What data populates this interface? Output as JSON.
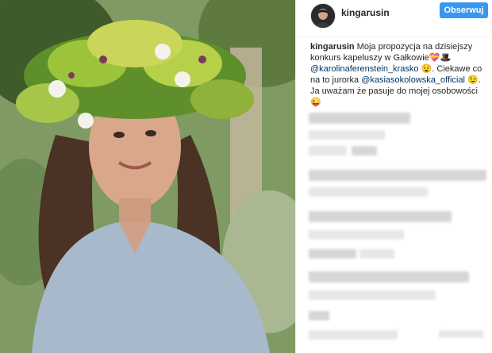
{
  "post": {
    "username": "kingarusin",
    "follow_label": "Obserwuj",
    "caption": {
      "author": "kingarusin",
      "line1": " Moja propozycja na dzisiejszy konkurs kapeluszy w Gałkowie💝🎩",
      "mention1": "@karolinaferenstein_krasko",
      "line2": " 😧. Ciekawe co na to jurorka ",
      "mention2": "@kasiasokolowska_official",
      "line3": " 😉. Ja uważam że pasuje do mojej osobowości😜"
    }
  },
  "colors": {
    "follow_button": "#3897f0",
    "mention": "#003569",
    "text": "#262626"
  }
}
